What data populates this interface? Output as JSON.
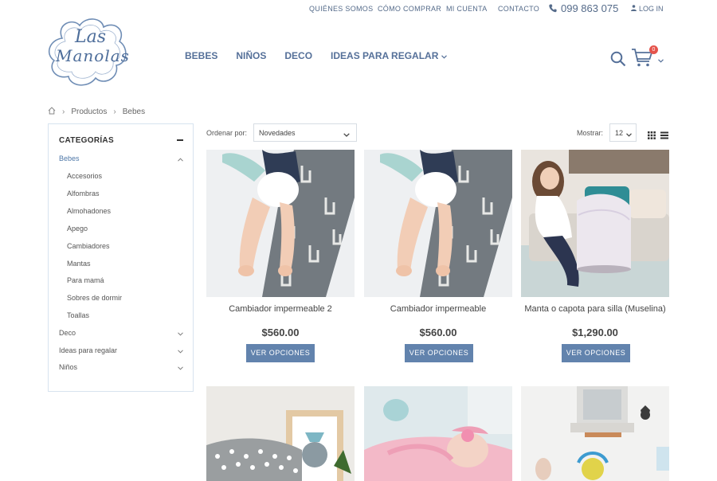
{
  "topbar": {
    "links": [
      "QUIÉNES SOMOS",
      "CÓMO COMPRAR",
      "MI CUENTA",
      "CONTACTO"
    ],
    "phone": "099 863 075",
    "login": "LOG IN"
  },
  "logo": {
    "line1": "Las",
    "line2": "Manolas"
  },
  "nav": {
    "items": [
      {
        "label": "BEBES"
      },
      {
        "label": "NIÑOS"
      },
      {
        "label": "DECO"
      },
      {
        "label": "IDEAS PARA REGALAR"
      }
    ]
  },
  "cart": {
    "count": "0"
  },
  "breadcrumb": {
    "items": [
      "Productos",
      "Bebes"
    ]
  },
  "sidebar": {
    "title": "CATEGORÍAS",
    "categories": [
      {
        "label": "Bebes"
      },
      {
        "label": "Accesorios"
      },
      {
        "label": "Alfombras"
      },
      {
        "label": "Almohadones"
      },
      {
        "label": "Apego"
      },
      {
        "label": "Cambiadores"
      },
      {
        "label": "Mantas"
      },
      {
        "label": "Para mamá"
      },
      {
        "label": "Sobres de dormir"
      },
      {
        "label": "Toallas"
      },
      {
        "label": "Deco"
      },
      {
        "label": "Ideas para regalar"
      },
      {
        "label": "Niños"
      }
    ]
  },
  "toolbar": {
    "sort_label": "Ordenar por:",
    "sort_value": "Novedades",
    "show_label": "Mostrar:",
    "show_value": "12"
  },
  "products": [
    {
      "name": "Cambiador impermeable 2",
      "price": "$560.00",
      "button": "VER OPCIONES"
    },
    {
      "name": "Cambiador impermeable",
      "price": "$560.00",
      "button": "VER OPCIONES"
    },
    {
      "name": "Manta o capota para silla (Muselina)",
      "price": "$1,290.00",
      "button": "VER OPCIONES"
    }
  ],
  "colors": {
    "accent": "#557099",
    "button": "#6283ad",
    "badge": "#e5534b"
  }
}
